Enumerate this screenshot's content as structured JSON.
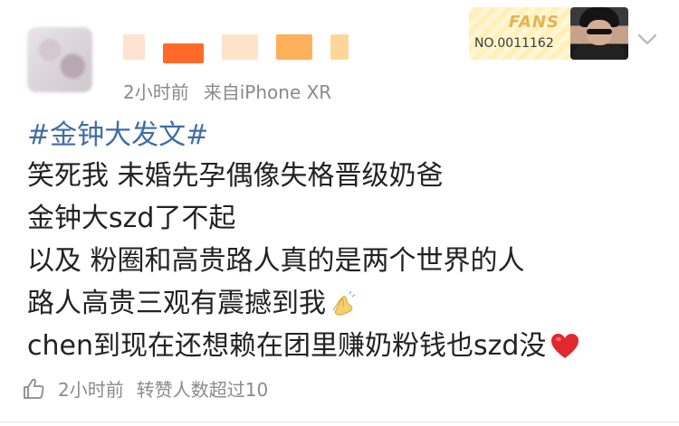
{
  "header": {
    "meta_time": "2小时前",
    "meta_source": "来自iPhone XR",
    "fans_badge": {
      "label": "FANS",
      "number": "NO.0011162"
    },
    "more_icon": "chevron-down-icon"
  },
  "post": {
    "hashtag": "#金钟大发文#",
    "lines": [
      "笑死我 未婚先孕偶像失格晋级奶爸",
      "金钟大szd了不起",
      "以及 粉圈和高贵路人真的是两个世界的人",
      "路人高贵三观有震撼到我",
      "chen到现在还想赖在团里赚奶粉钱也szd没"
    ],
    "emojis": [
      "folded-hands-emoji",
      "red-heart-emoji"
    ]
  },
  "footer": {
    "time": "2小时前",
    "repost_info": "转赞人数超过10",
    "like_icon": "thumbs-up-icon"
  },
  "colors": {
    "hashtag": "#3f6ea5",
    "body_text": "#222222",
    "meta_text": "#8a8a8a",
    "fans_gold": "#e3b25a",
    "heart": "#e0282e"
  }
}
